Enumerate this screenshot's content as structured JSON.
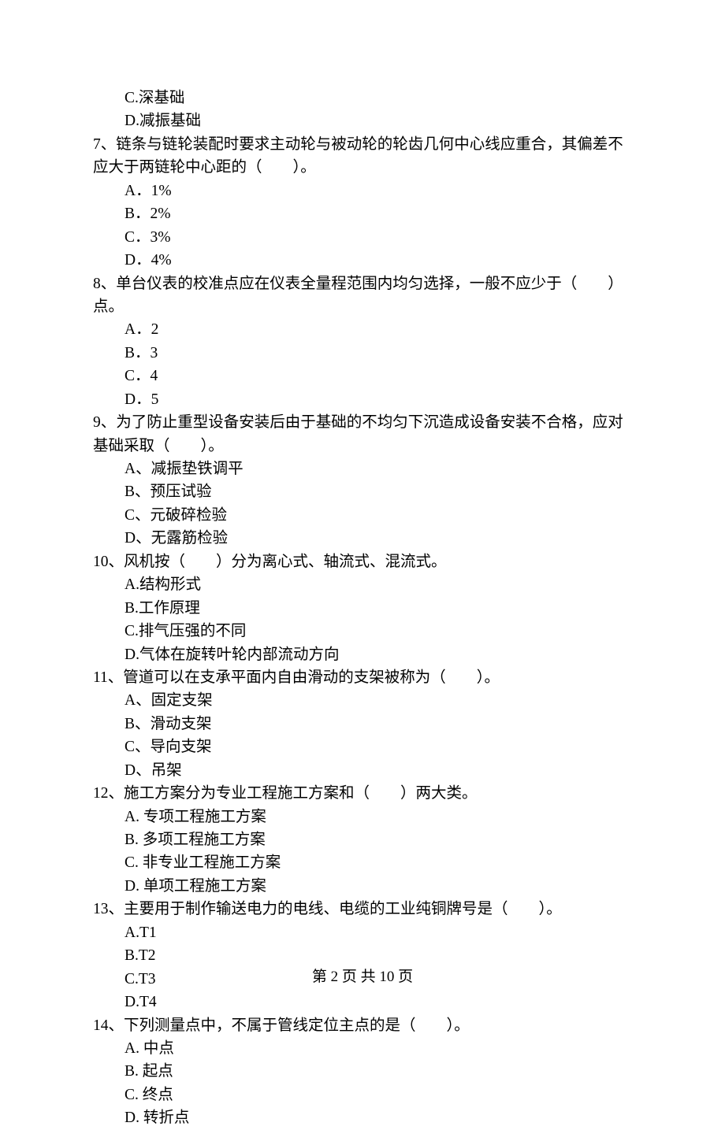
{
  "q6": {
    "optC": "C.深基础",
    "optD": "D.减振基础"
  },
  "q7": {
    "stem": "7、链条与链轮装配时要求主动轮与被动轮的轮齿几何中心线应重合，其偏差不应大于两链轮中心距的（　　）。",
    "optA": "A．1%",
    "optB": "B．2%",
    "optC": "C．3%",
    "optD": "D．4%"
  },
  "q8": {
    "stem": "8、单台仪表的校准点应在仪表全量程范围内均匀选择，一般不应少于（　　）点。",
    "optA": "A．2",
    "optB": "B．3",
    "optC": "C．4",
    "optD": "D．5"
  },
  "q9": {
    "stem": "9、为了防止重型设备安装后由于基础的不均匀下沉造成设备安装不合格，应对基础采取（　　）。",
    "optA": "A、减振垫铁调平",
    "optB": "B、预压试验",
    "optC": "C、元破碎检验",
    "optD": "D、无露筋检验"
  },
  "q10": {
    "stem": "10、风机按（　　）分为离心式、轴流式、混流式。",
    "optA": "A.结构形式",
    "optB": "B.工作原理",
    "optC": "C.排气压强的不同",
    "optD": "D.气体在旋转叶轮内部流动方向"
  },
  "q11": {
    "stem": "11、管道可以在支承平面内自由滑动的支架被称为（　　）。",
    "optA": "A、固定支架",
    "optB": "B、滑动支架",
    "optC": "C、导向支架",
    "optD": "D、吊架"
  },
  "q12": {
    "stem": "12、施工方案分为专业工程施工方案和（　　）两大类。",
    "optA": "A. 专项工程施工方案",
    "optB": "B. 多项工程施工方案",
    "optC": "C. 非专业工程施工方案",
    "optD": "D. 单项工程施工方案"
  },
  "q13": {
    "stem": "13、主要用于制作输送电力的电线、电缆的工业纯铜牌号是（　　）。",
    "optA": "A.T1",
    "optB": "B.T2",
    "optC": "C.T3",
    "optD": "D.T4"
  },
  "q14": {
    "stem": "14、下列测量点中，不属于管线定位主点的是（　　）。",
    "optA": "A. 中点",
    "optB": "B. 起点",
    "optC": "C. 终点",
    "optD": "D. 转折点"
  },
  "footer": "第 2 页 共 10 页"
}
